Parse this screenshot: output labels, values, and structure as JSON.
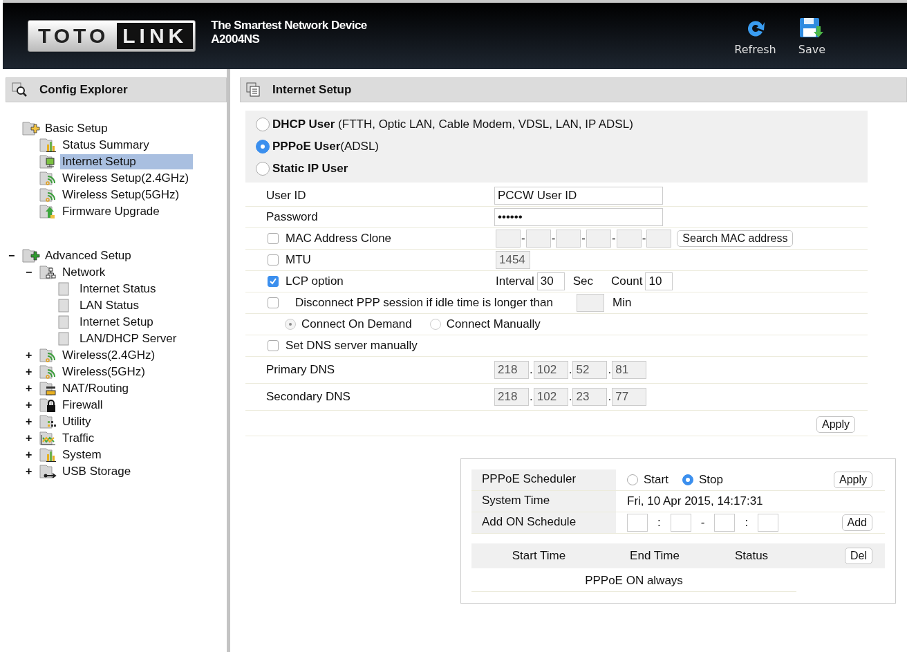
{
  "header": {
    "logo": [
      "TOTO",
      "LINK"
    ],
    "tagline": "The Smartest Network Device",
    "model": "A2004NS",
    "actions": [
      {
        "kind": "refresh",
        "label": "Refresh"
      },
      {
        "kind": "save",
        "label": "Save"
      }
    ]
  },
  "sidebar": {
    "title": "Config Explorer",
    "tree": [
      {
        "label": "Basic Setup",
        "kind": "basic",
        "selected": false,
        "children": [
          {
            "label": "Status Summary",
            "kind": "chart",
            "selected": false
          },
          {
            "label": "Internet Setup",
            "kind": "monitor",
            "selected": true
          },
          {
            "label": "Wireless Setup(2.4GHz)",
            "kind": "wireless",
            "selected": false
          },
          {
            "label": "Wireless Setup(5GHz)",
            "kind": "wireless",
            "selected": false
          },
          {
            "label": "Firmware Upgrade",
            "kind": "upgrade",
            "selected": false
          }
        ]
      },
      {
        "label": "Advanced Setup",
        "kind": "advanced",
        "toggle": "−",
        "selected": false,
        "children": [
          {
            "label": "Network",
            "kind": "network",
            "toggle": "−",
            "selected": false,
            "children": [
              {
                "label": "Internet Status",
                "kind": "page",
                "selected": false
              },
              {
                "label": "LAN Status",
                "kind": "page",
                "selected": false
              },
              {
                "label": "Internet Setup",
                "kind": "page",
                "selected": false
              },
              {
                "label": "LAN/DHCP Server",
                "kind": "page",
                "selected": false
              }
            ]
          },
          {
            "label": "Wireless(2.4GHz)",
            "kind": "wireless",
            "toggle": "+",
            "selected": false
          },
          {
            "label": "Wireless(5GHz)",
            "kind": "wireless",
            "toggle": "+",
            "selected": false
          },
          {
            "label": "NAT/Routing",
            "kind": "nat",
            "toggle": "+",
            "selected": false
          },
          {
            "label": "Firewall",
            "kind": "lock",
            "toggle": "+",
            "selected": false
          },
          {
            "label": "Utility",
            "kind": "utility",
            "toggle": "+",
            "selected": false
          },
          {
            "label": "Traffic",
            "kind": "traffic",
            "toggle": "+",
            "selected": false
          },
          {
            "label": "System",
            "kind": "chart",
            "toggle": "+",
            "selected": false
          },
          {
            "label": "USB Storage",
            "kind": "usb",
            "toggle": "+",
            "selected": false
          }
        ]
      }
    ]
  },
  "main": {
    "title": "Internet Setup",
    "wan_types": [
      {
        "label": "**DHCP User** (FTTH, Optic LAN, Cable Modem, VDSL, LAN, IP ADSL)",
        "selected": false
      },
      {
        "label": "**PPPoE User**(ADSL)",
        "selected": true
      },
      {
        "label": "**Static IP User**",
        "selected": false
      }
    ],
    "form": [
      {
        "kind": "text",
        "label": "User ID",
        "value": "PCCW User ID"
      },
      {
        "kind": "text",
        "label": "Password",
        "value": "••••••"
      },
      {
        "kind": "mac",
        "label": "MAC Address Clone",
        "checked": false,
        "separators": [
          "-",
          "-",
          "-",
          "-",
          "-"
        ],
        "button": "Search MAC address"
      },
      {
        "kind": "mtu",
        "label": "MTU",
        "checked": false,
        "value": "1454",
        "disabled": true
      },
      {
        "kind": "lcp",
        "label": "LCP option",
        "checked": true,
        "interval_label": "Interval",
        "interval": "30",
        "interval_unit": "Sec",
        "count_label": "Count",
        "count": "10"
      },
      {
        "kind": "idle",
        "label": "Disconnect PPP session if idle time is longer than",
        "checked": false,
        "unit": "Min"
      },
      {
        "kind": "connect",
        "options": [
          {
            "label": "Connect On Demand",
            "selected": true,
            "disabled": true
          },
          {
            "label": "Connect Manually",
            "selected": false,
            "disabled": true
          }
        ]
      },
      {
        "kind": "check",
        "label": "Set DNS server manually",
        "checked": false
      },
      {
        "kind": "ip",
        "label": "Primary DNS",
        "octets": [
          "218",
          "102",
          "52",
          "81"
        ],
        "separators": [
          ".",
          ".",
          "."
        ]
      },
      {
        "kind": "ip",
        "label": "Secondary DNS",
        "octets": [
          "218",
          "102",
          "23",
          "77"
        ],
        "separators": [
          ".",
          ".",
          "."
        ]
      }
    ],
    "apply": "Apply",
    "scheduler": {
      "label": "PPPoE Scheduler",
      "options": [
        {
          "label": "Start",
          "selected": false
        },
        {
          "label": "Stop",
          "selected": true
        }
      ],
      "apply": "Apply",
      "time_label": "System Time",
      "time": "Fri, 10 Apr 2015, 14:17:31",
      "add_label": "Add ON Schedule",
      "add_separators": [
        ":",
        "-",
        ":"
      ],
      "add": "Add",
      "columns": [
        "Start Time",
        "End Time",
        "Status"
      ],
      "delete": "Del",
      "empty": "PPPoE ON always"
    }
  }
}
